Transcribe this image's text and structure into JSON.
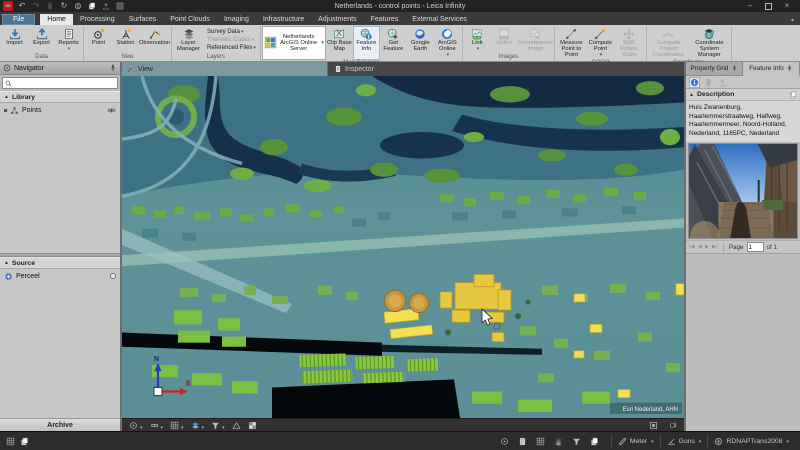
{
  "titlebar": {
    "title": "Netherlands - control points - Leica Infinity"
  },
  "ribbon": {
    "tabs": [
      "File",
      "Home",
      "Processing",
      "Surfaces",
      "Point Clouds",
      "Imaging",
      "Infrastructure",
      "Adjustments",
      "Features",
      "External Services"
    ],
    "groups": {
      "data": {
        "label": "Data",
        "import": "Import",
        "export": "Export",
        "reports": "Reports"
      },
      "new": {
        "label": "New",
        "point": "Point",
        "station": "Station",
        "observation": "Observation"
      },
      "layers": {
        "label": "Layers",
        "layer_manager": "Layer Manager",
        "survey_data": "Survey Data",
        "thematic_codes": "Thematic Codes",
        "referenced_files": "Referenced Files"
      },
      "map_services": {
        "label": "Map Services",
        "server": "Netherlands ArcGIS Online Server",
        "clip_base_map": "Clip Base Map",
        "feature_info": "Feature Info",
        "get_feature": "Get Feature",
        "google_earth": "Google Earth",
        "arcgis_online": "ArcGIS Online"
      },
      "images": {
        "label": "Images",
        "link": "Link",
        "unlink": "Unlink",
        "georeference": "Georeference Image"
      },
      "cogo": {
        "label": "COGO",
        "measure": "Measure Point to Point",
        "compute_point": "Compute Point",
        "shift_rotate_scale": "Shift, Rotate, Scale"
      },
      "coordinates": {
        "label": "Coordinates",
        "compute_project": "Compute Project Coordinates",
        "system_manager": "Coordinate System Manager"
      }
    }
  },
  "navigator": {
    "title": "Navigator",
    "library": {
      "label": "Library",
      "points_item": "Points"
    },
    "source": {
      "label": "Source",
      "parcel_item": "Perceel"
    },
    "archive": "Archive"
  },
  "viewport": {
    "view_tab": "View",
    "inspector_tab": "Inspector",
    "axis_north": "N",
    "axis_east": "E",
    "attribution": "Esri Nederland, AHN"
  },
  "feature_panel": {
    "property_grid_tab": "Property Grid",
    "feature_info_tab": "Feature Info",
    "description_label": "Description",
    "description_text": "Huis Zwanenburg, Haarlemmerstraatweg, Halfweg, Haarlemmermeer, Noord-Holland, Nederland, 1165PC, Nederland",
    "pager": {
      "page_label": "Page",
      "page_value": "1",
      "of_label": "of 1"
    }
  },
  "statusbar": {
    "distance_unit": "Meter",
    "angle_unit": "Gons",
    "coordinate_system": "RDNAPTrans2008"
  },
  "colors": {
    "accent_blue": "#2a7fd4",
    "selection_yellow": "#e8c83e",
    "map_teal": "#5f9399",
    "tank_orange": "#c9953f"
  }
}
